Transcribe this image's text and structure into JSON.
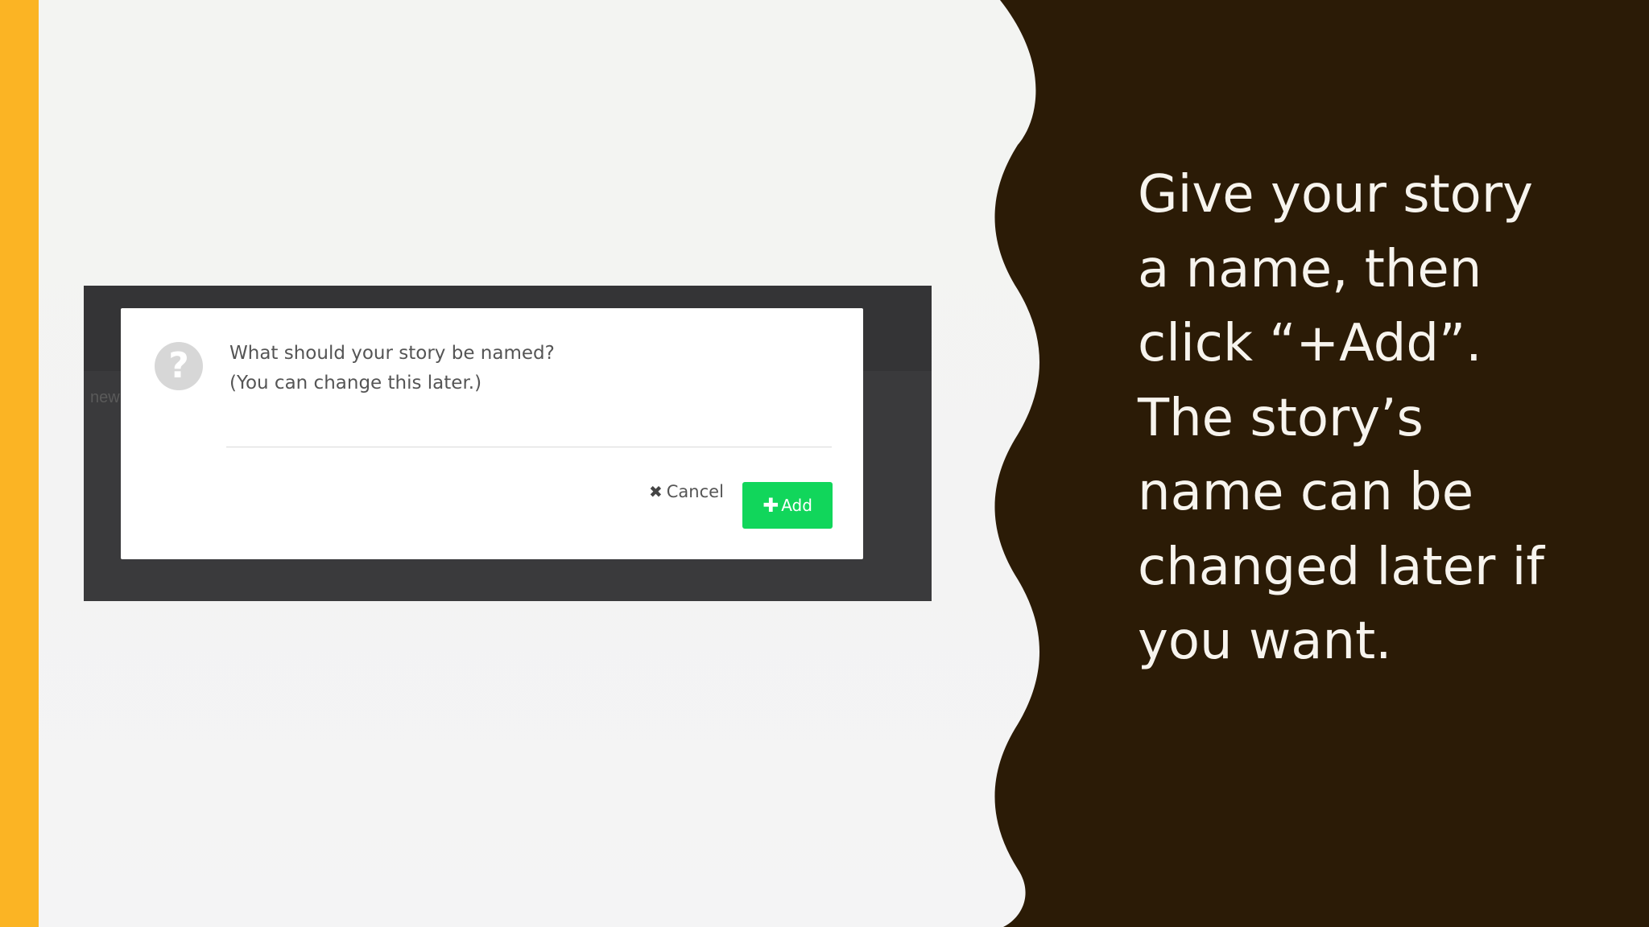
{
  "colors": {
    "accent": "#fbb424",
    "panel": "#2b1b06",
    "add_button": "#11d65b",
    "background": "#f3f3f3"
  },
  "screenshot": {
    "behind_text": "new",
    "dialog": {
      "icon": "question-circle-icon",
      "prompt_line1": "What should your story be named?",
      "prompt_line2": "(You can change this later.)",
      "input_value": "",
      "cancel_icon": "close-icon",
      "cancel_label": "Cancel",
      "add_icon": "plus-icon",
      "add_label": "Add"
    }
  },
  "caption": {
    "lines": [
      "Give your story",
      "a name, then",
      "click “+Add”.",
      "The story’s",
      "name can be",
      "changed later if",
      "you want."
    ]
  }
}
